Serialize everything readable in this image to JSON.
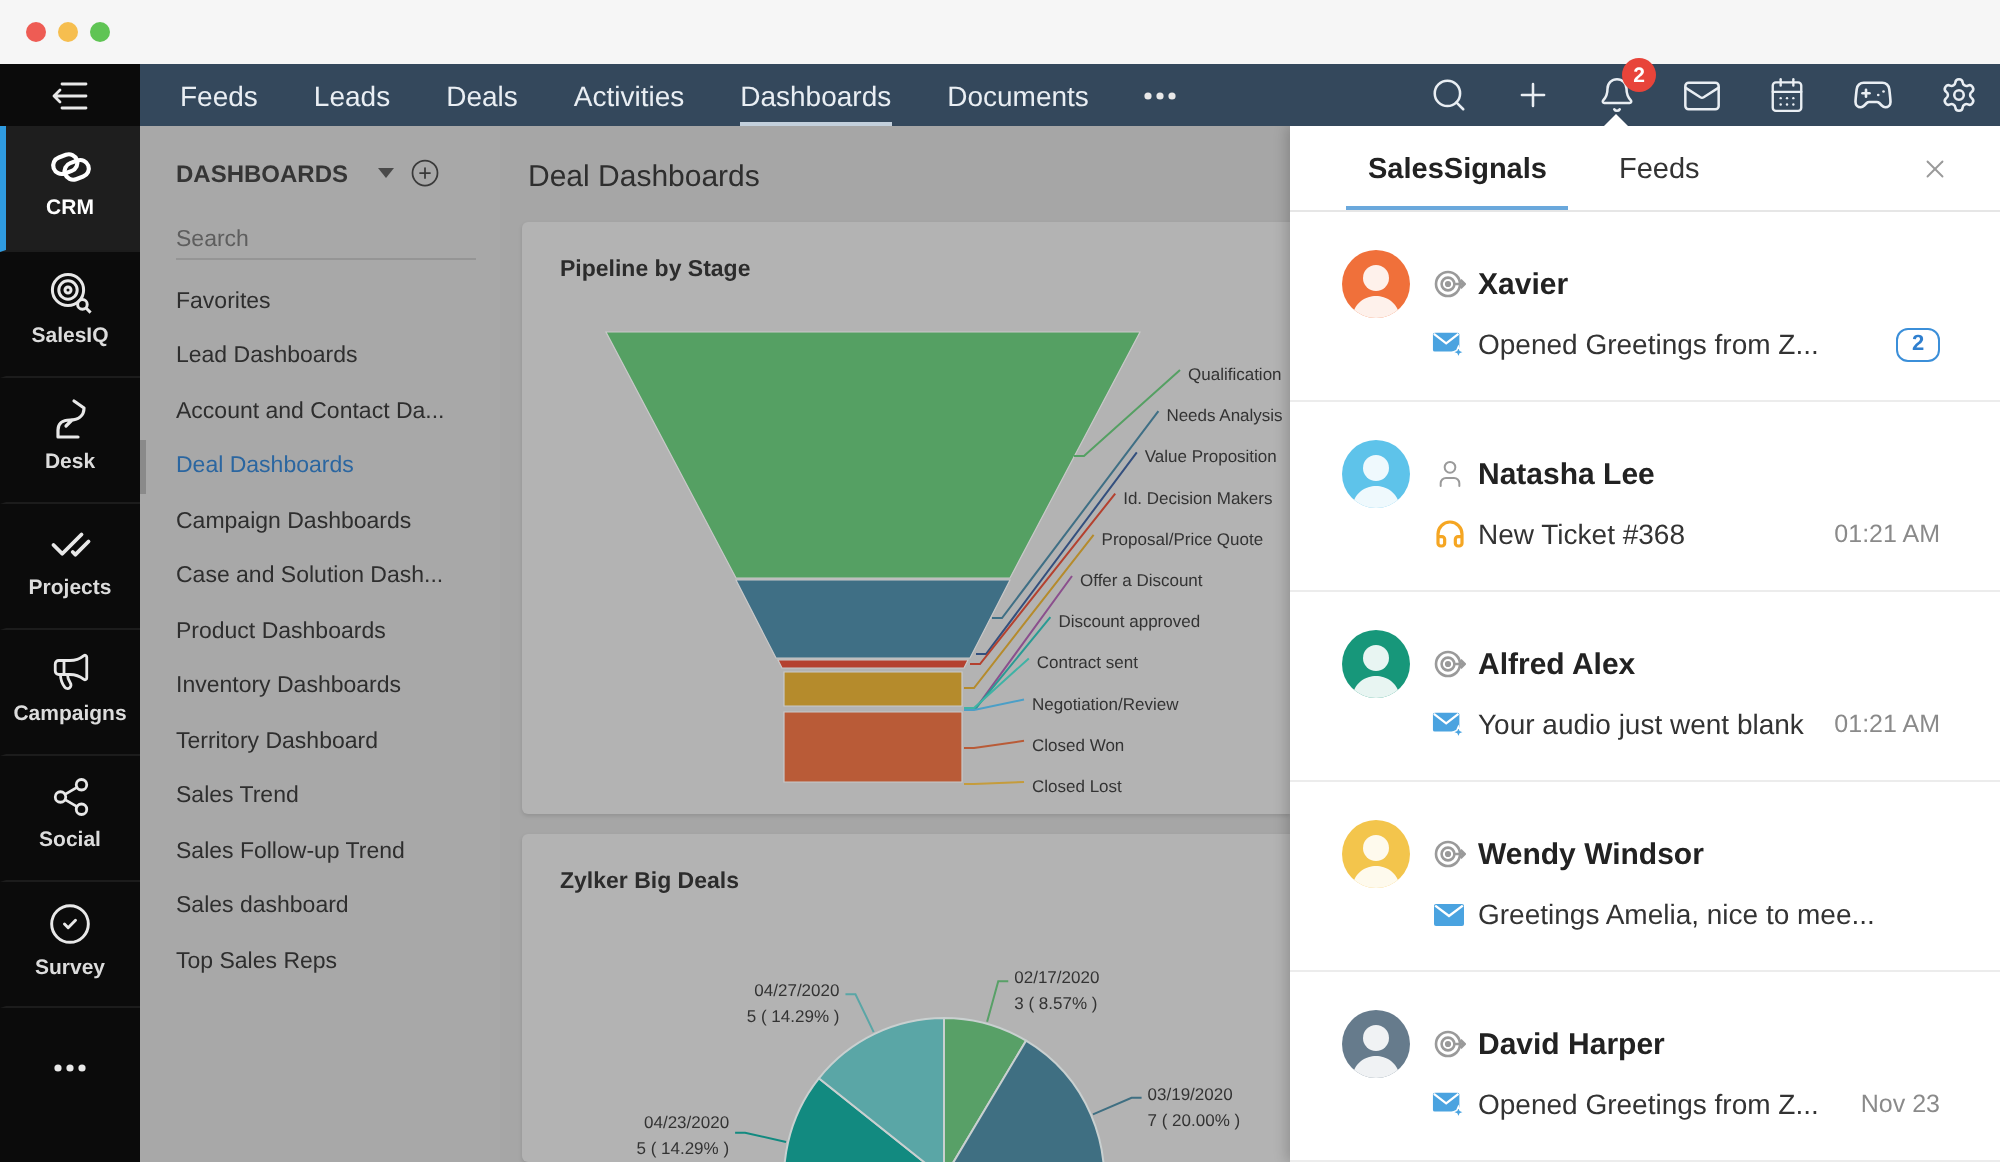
{
  "app_bar": {
    "items": [
      {
        "label": "CRM",
        "selected": true
      },
      {
        "label": "SalesIQ",
        "selected": false
      },
      {
        "label": "Desk",
        "selected": false
      },
      {
        "label": "Projects",
        "selected": false
      },
      {
        "label": "Campaigns",
        "selected": false
      },
      {
        "label": "Social",
        "selected": false
      },
      {
        "label": "Survey",
        "selected": false
      }
    ]
  },
  "top_nav": {
    "tabs": [
      {
        "label": "Feeds",
        "selected": false
      },
      {
        "label": "Leads",
        "selected": false
      },
      {
        "label": "Deals",
        "selected": false
      },
      {
        "label": "Activities",
        "selected": false
      },
      {
        "label": "Dashboards",
        "selected": true
      },
      {
        "label": "Documents",
        "selected": false
      }
    ],
    "notification_count": "2"
  },
  "sidebar": {
    "title": "DASHBOARDS",
    "search": {
      "placeholder": "Search"
    },
    "items": [
      {
        "label": "Favorites",
        "selected": false
      },
      {
        "label": "Lead Dashboards",
        "selected": false
      },
      {
        "label": "Account and Contact Da...",
        "selected": false
      },
      {
        "label": "Deal Dashboards",
        "selected": true
      },
      {
        "label": "Campaign Dashboards",
        "selected": false
      },
      {
        "label": "Case and Solution Dash...",
        "selected": false
      },
      {
        "label": "Product Dashboards",
        "selected": false
      },
      {
        "label": "Inventory Dashboards",
        "selected": false
      },
      {
        "label": "Territory Dashboard",
        "selected": false
      },
      {
        "label": "Sales Trend",
        "selected": false
      },
      {
        "label": "Sales Follow-up Trend",
        "selected": false
      },
      {
        "label": "Sales dashboard",
        "selected": false
      },
      {
        "label": "Top Sales Reps",
        "selected": false
      }
    ]
  },
  "main": {
    "title": "Deal Dashboards",
    "cards": [
      {
        "kind": "funnel",
        "title": "Pipeline by Stage",
        "stages": [
          {
            "label": "Qualification",
            "color": "#55a063"
          },
          {
            "label": "Needs Analysis",
            "color": "#3f6f85"
          },
          {
            "label": "Value Proposition",
            "color": "#34507e"
          },
          {
            "label": "Id. Decision Makers",
            "color": "#b4412f"
          },
          {
            "label": "Proposal/Price Quote",
            "color": "#b58b2c"
          },
          {
            "label": "Offer a Discount",
            "color": "#8b4f8d"
          },
          {
            "label": "Discount approved",
            "color": "#2a9b94"
          },
          {
            "label": "Contract sent",
            "color": "#3fb3a5"
          },
          {
            "label": "Negotiation/Review",
            "color": "#4b9fc7"
          },
          {
            "label": "Closed Won",
            "color": "#b95b37"
          },
          {
            "label": "Closed Lost",
            "color": "#c59c3c"
          }
        ]
      },
      {
        "kind": "chart",
        "chart_data": {
          "type": "pie",
          "title": "Zylker Big Deals",
          "categories": [
            "02/17/2020",
            "03/19/2020",
            "04/23/2020",
            "04/27/2020"
          ],
          "values": [
            8.57,
            20.0,
            14.29,
            14.29
          ],
          "value_labels": [
            "3 ( 8.57% )",
            "7 ( 20.00% )",
            "5 ( 14.29% )",
            "5 ( 14.29% )"
          ]
        }
      }
    ]
  },
  "signals_panel": {
    "tabs": [
      {
        "label": "SalesSignals",
        "selected": true
      },
      {
        "label": "Feeds",
        "selected": false
      }
    ],
    "items": [
      {
        "name": "Xavier",
        "color": "#f0703a",
        "kind": "opened",
        "message": "Opened Greetings from Z...",
        "badge": "2"
      },
      {
        "name": "Natasha Lee",
        "color": "#5ec3ea",
        "kind": "ticket",
        "message": "New Ticket #368",
        "time": "01:21 AM"
      },
      {
        "name": "Alfred Alex",
        "color": "#17977a",
        "kind": "opened",
        "message": "Your audio just went blank",
        "time": "01:21 AM"
      },
      {
        "name": "Wendy Windsor",
        "color": "#f3c54c",
        "kind": "mail",
        "message": "Greetings Amelia, nice to mee..."
      },
      {
        "name": "David Harper",
        "color": "#667b8c",
        "kind": "opened",
        "message": "Opened Greetings from Z...",
        "time": "Nov 23"
      }
    ]
  }
}
